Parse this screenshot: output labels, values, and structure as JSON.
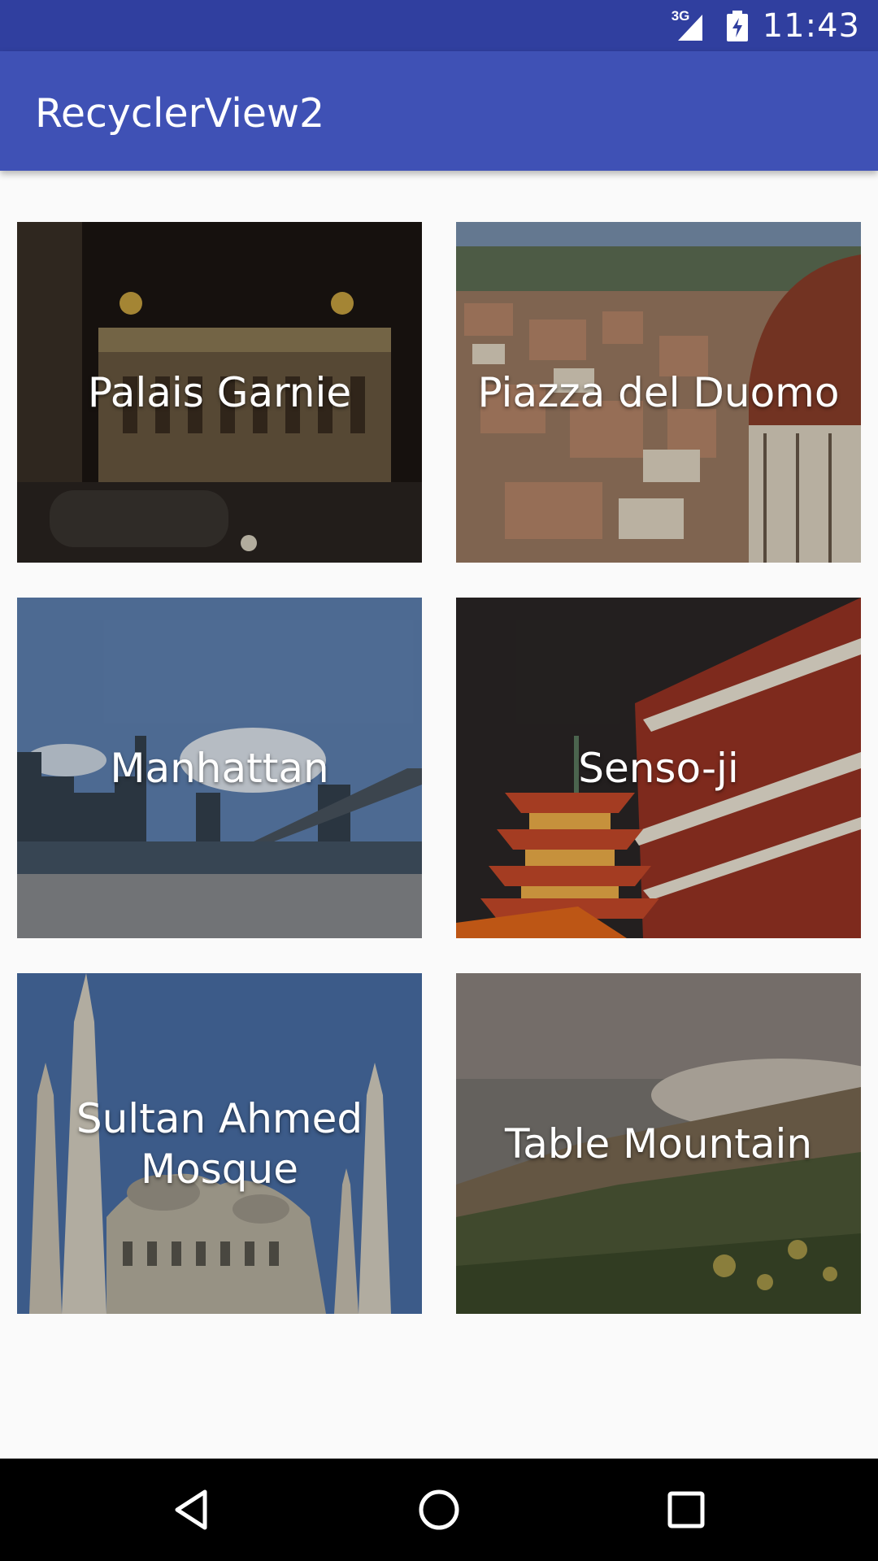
{
  "status_bar": {
    "time": "11:43",
    "network": "3G",
    "icons": [
      "signal-icon",
      "battery-icon"
    ],
    "background": "#303f9f"
  },
  "app_bar": {
    "title": "RecyclerView2",
    "background": "#3f51b5"
  },
  "cards": [
    {
      "label": "Palais Garnie"
    },
    {
      "label": "Piazza del Duomo"
    },
    {
      "label": "Manhattan"
    },
    {
      "label": "Senso-ji"
    },
    {
      "label": "Sultan Ahmed Mosque"
    },
    {
      "label": "Table Mountain"
    }
  ],
  "nav_bar": {
    "buttons": [
      "back-icon",
      "home-icon",
      "recents-icon"
    ]
  }
}
